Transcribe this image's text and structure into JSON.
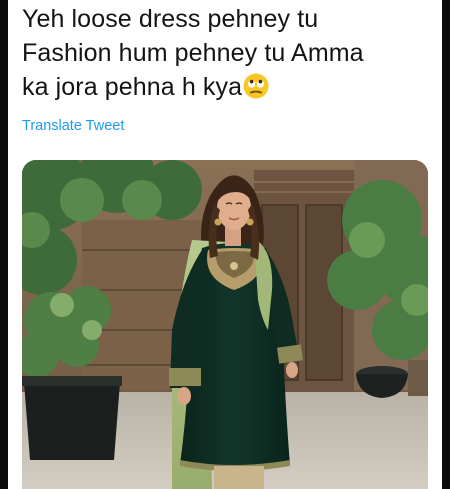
{
  "tweet": {
    "text_lines": [
      "Yeh loose dress pehney tu",
      "Fashion hum pehney tu Amma",
      "ka jora pehna h kya"
    ],
    "emoji": "face-with-rolling-eyes-emoji",
    "translate_label": "Translate Tweet"
  },
  "colors": {
    "link": "#1d9bf0",
    "text": "#141414",
    "dress": "#0f2c22",
    "dupatta": "#a9bf7c",
    "embroidery": "#c9b07a"
  }
}
